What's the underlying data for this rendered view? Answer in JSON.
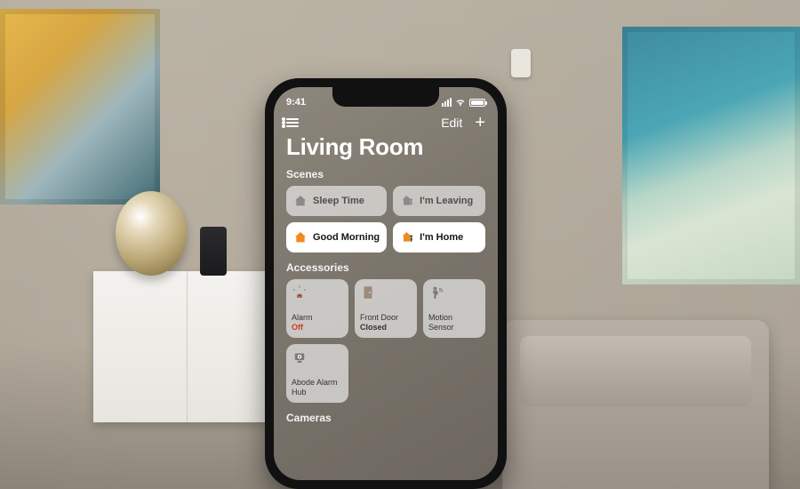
{
  "status": {
    "time": "9:41"
  },
  "nav": {
    "edit": "Edit"
  },
  "title": "Living Room",
  "sections": {
    "scenes": "Scenes",
    "accessories": "Accessories",
    "cameras": "Cameras"
  },
  "scenes": [
    {
      "label": "Sleep Time",
      "icon": "house-icon",
      "active": false
    },
    {
      "label": "I'm Leaving",
      "icon": "house-person-icon",
      "active": false
    },
    {
      "label": "Good Morning",
      "icon": "house-icon",
      "active": true
    },
    {
      "label": "I'm Home",
      "icon": "house-person-icon",
      "active": true
    }
  ],
  "accessories": [
    {
      "name": "Alarm",
      "status": "Off",
      "status_kind": "off",
      "icon": "siren-icon"
    },
    {
      "name": "Front Door",
      "status": "Closed",
      "status_kind": "",
      "icon": "door-icon"
    },
    {
      "name": "Motion Sensor",
      "status": "",
      "status_kind": "",
      "icon": "motion-icon"
    },
    {
      "name": "Abode Alarm Hub",
      "status": "",
      "status_kind": "",
      "icon": "camera-icon"
    }
  ],
  "colors": {
    "accent": "#f08b1d",
    "alert": "#d13a20"
  }
}
